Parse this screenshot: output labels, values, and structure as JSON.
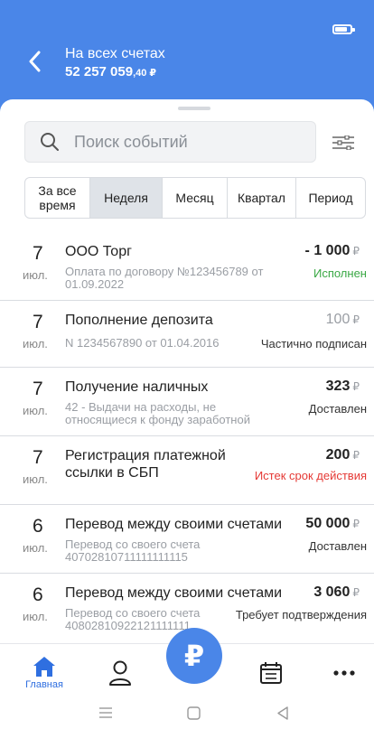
{
  "header": {
    "title": "На всех счетах",
    "amount_main": "52 257 059",
    "amount_fraction": ",40 ₽",
    "accent_color": "#4a86e8"
  },
  "search": {
    "placeholder": "Поиск событий"
  },
  "periods": [
    {
      "label": "За все время",
      "active": false
    },
    {
      "label": "Неделя",
      "active": true
    },
    {
      "label": "Месяц",
      "active": false
    },
    {
      "label": "Квартал",
      "active": false
    },
    {
      "label": "Период",
      "active": false
    }
  ],
  "events": [
    {
      "day": "7",
      "month": "июл.",
      "title": "ООО Торг",
      "sub": "Оплата по договору №123456789 от 01.09.2022",
      "amount": "- 1 000",
      "status": "Исполнен",
      "status_color": "#3aa845"
    },
    {
      "day": "7",
      "month": "июл.",
      "title": "Пополнение депозита",
      "sub": "N 1234567890 от 01.04.2016",
      "amount": "100",
      "status": "Частично подписан",
      "status_color": "#333333"
    },
    {
      "day": "7",
      "month": "июл.",
      "title": "Получение наличных",
      "sub": "42 - Выдачи на расходы, не относящиеся к фонду заработной",
      "amount": "323",
      "status": "Доставлен",
      "status_color": "#333333"
    },
    {
      "day": "7",
      "month": "июл.",
      "title": "Регистрация платежной ссылки в СБП",
      "sub": "",
      "amount": "200",
      "status": "Истек срок действия",
      "status_color": "#e53935"
    },
    {
      "day": "6",
      "month": "июл.",
      "title": "Перевод между своими счетами",
      "sub": "Перевод со своего счета 40702810711111111115",
      "amount": "50 000",
      "status": "Доставлен",
      "status_color": "#333333"
    },
    {
      "day": "6",
      "month": "июл.",
      "title": "Перевод между своими счетами",
      "sub": "Перевод со своего счета 40802810922121111111",
      "amount": "3 060",
      "status": "Требует подтверждения",
      "status_color": "#333333"
    }
  ],
  "currency_symbol": "₽",
  "tabbar": {
    "home_label": "Главная",
    "fab_symbol": "₽"
  },
  "icons": [
    "back-arrow-icon",
    "battery-icon",
    "search-icon",
    "filter-icon",
    "home-icon",
    "profile-icon",
    "ruble-icon",
    "calendar-icon",
    "more-icon",
    "menu-icon",
    "square-icon",
    "triangle-back-icon"
  ]
}
